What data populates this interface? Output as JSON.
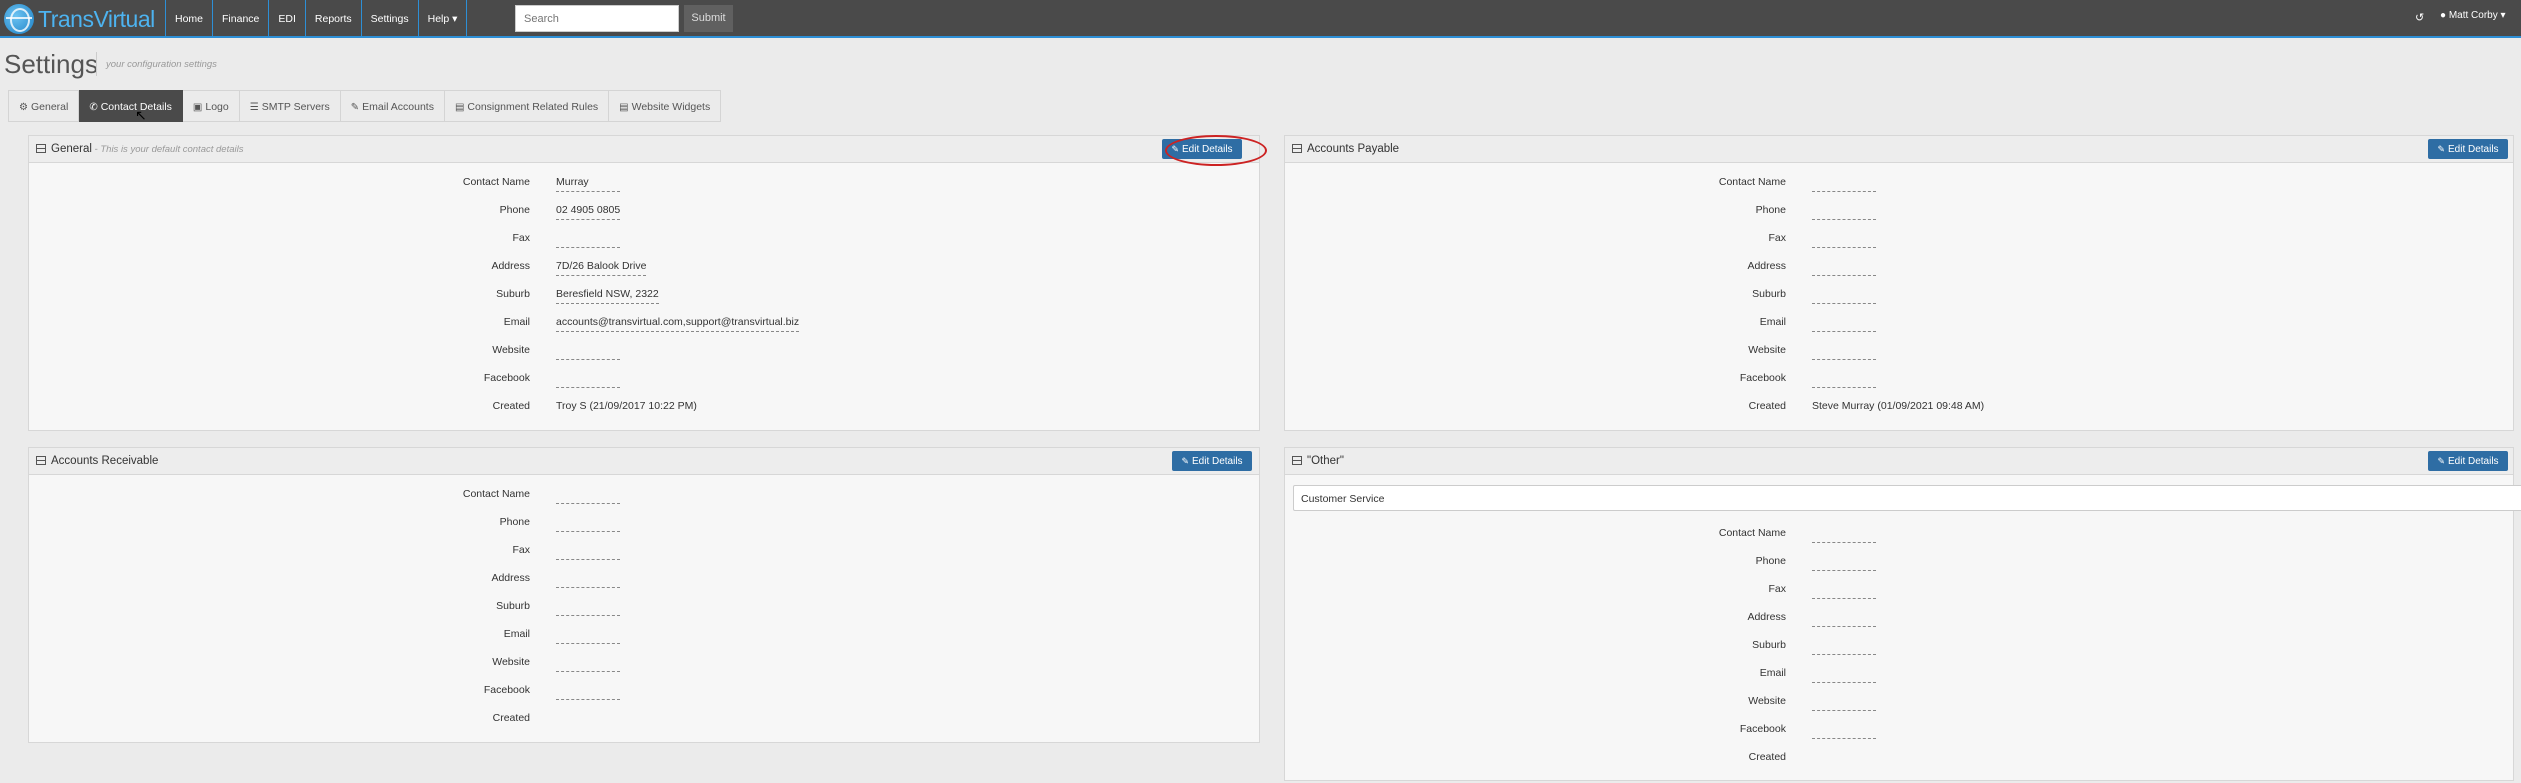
{
  "brand": {
    "name": "TransVirtual"
  },
  "nav": {
    "items": [
      "Home",
      "Finance",
      "EDI",
      "Reports",
      "Settings",
      "Help ▾"
    ]
  },
  "search": {
    "placeholder": "Search",
    "submit_label": "Submit"
  },
  "user": {
    "name": "Matt Corby ▾"
  },
  "page": {
    "title": "Settings",
    "subtitle": "your configuration settings"
  },
  "tabs": [
    {
      "label": "General",
      "icon": "gear-icon"
    },
    {
      "label": "Contact Details",
      "icon": "phone-icon"
    },
    {
      "label": "Logo",
      "icon": "image-icon"
    },
    {
      "label": "SMTP Servers",
      "icon": "list-icon"
    },
    {
      "label": "Email Accounts",
      "icon": "pencil-icon"
    },
    {
      "label": "Consignment Related Rules",
      "icon": "file-icon"
    },
    {
      "label": "Website Widgets",
      "icon": "file-icon"
    }
  ],
  "edit_label": "Edit Details",
  "field_labels": [
    "Contact Name",
    "Phone",
    "Fax",
    "Address",
    "Suburb",
    "Email",
    "Website",
    "Facebook",
    "Created"
  ],
  "panels": {
    "general": {
      "title": "General",
      "subtitle": " - This is your default contact details",
      "values": [
        "Murray",
        "02 4905 0805",
        "",
        "7D/26 Balook Drive",
        "Beresfield NSW, 2322",
        "accounts@transvirtual.com,support@transvirtual.biz",
        "",
        "",
        "Troy S (21/09/2017 10:22 PM)"
      ]
    },
    "payable": {
      "title": "Accounts Payable",
      "values": [
        "",
        "",
        "",
        "",
        "",
        "",
        "",
        "",
        "Steve Murray (01/09/2021 09:48 AM)"
      ]
    },
    "receivable": {
      "title": "Accounts Receivable",
      "values": [
        "",
        "",
        "",
        "",
        "",
        "",
        "",
        "",
        ""
      ]
    },
    "other": {
      "title": "\"Other\"",
      "select_value": "Customer Service",
      "values": [
        "",
        "",
        "",
        "",
        "",
        "",
        "",
        "",
        ""
      ]
    }
  },
  "colors": {
    "navbar": "#4a4a4a",
    "accent": "#2d8fd6",
    "button": "#2e6da4",
    "highlight": "#cc2222"
  }
}
